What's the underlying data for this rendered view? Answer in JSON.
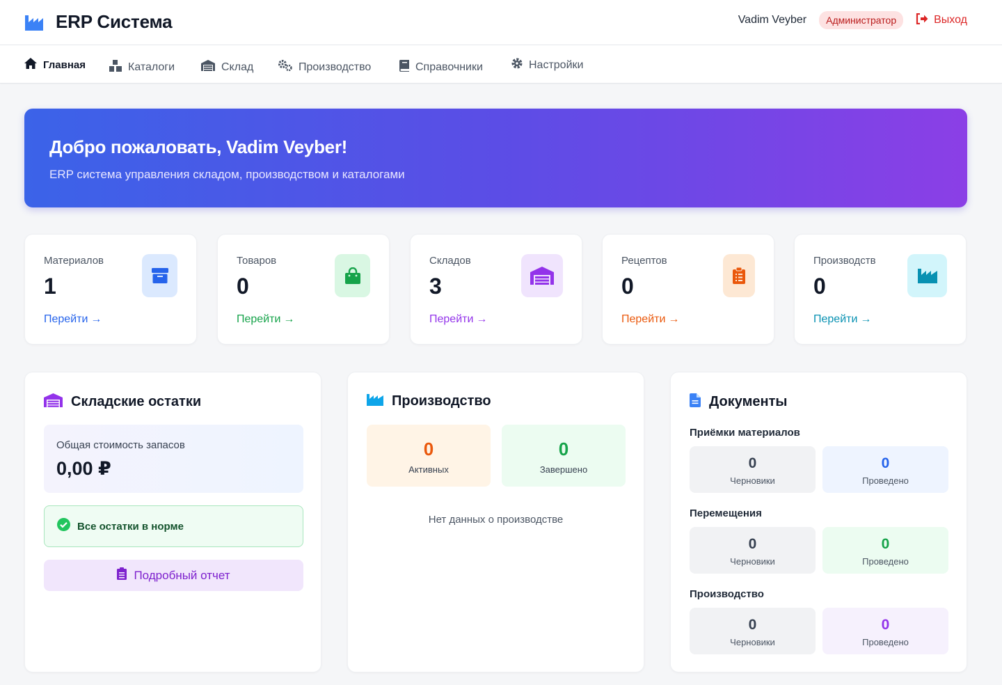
{
  "header": {
    "brand_title": "ERP Система",
    "user_name": "Vadim Veyber",
    "role": "Администратор",
    "logout_label": "Выход"
  },
  "nav": {
    "items": [
      {
        "label": "Главная",
        "icon": "home-icon",
        "active": true
      },
      {
        "label": "Каталоги",
        "icon": "cubes-icon"
      },
      {
        "label": "Склад",
        "icon": "warehouse-icon"
      },
      {
        "label": "Производство",
        "icon": "gears-icon"
      },
      {
        "label": "Справочники",
        "icon": "book-icon"
      },
      {
        "label": "Настройки",
        "icon": "cog-icon"
      }
    ]
  },
  "banner": {
    "title": "Добро пожаловать, Vadim Veyber!",
    "subtitle": "ERP система управления складом, производством и каталогами"
  },
  "stats": [
    {
      "label": "Материалов",
      "value": "1",
      "link": "Перейти",
      "icon": "box-icon",
      "color": "#2563eb"
    },
    {
      "label": "Товаров",
      "value": "0",
      "link": "Перейти",
      "icon": "shopping-bag-icon",
      "color": "#16a34a"
    },
    {
      "label": "Складов",
      "value": "3",
      "link": "Перейти",
      "icon": "warehouse-icon",
      "color": "#9333ea"
    },
    {
      "label": "Рецептов",
      "value": "0",
      "link": "Перейти",
      "icon": "clipboard-list-icon",
      "color": "#ea580c"
    },
    {
      "label": "Производств",
      "value": "0",
      "link": "Перейти",
      "icon": "industry-icon",
      "color": "#0891b2"
    }
  ],
  "stock": {
    "title": "Складские остатки",
    "total_label": "Общая стоимость запасов",
    "total_value": "0,00 ₽",
    "status_text": "Все остатки в норме",
    "report_button": "Подробный отчет"
  },
  "production": {
    "title": "Производство",
    "active_value": "0",
    "active_label": "Активных",
    "done_value": "0",
    "done_label": "Завершено",
    "empty_text": "Нет данных о производстве"
  },
  "documents": {
    "title": "Документы",
    "sections": [
      {
        "title": "Приёмки материалов",
        "draft_value": "0",
        "draft_label": "Черновики",
        "posted_value": "0",
        "posted_label": "Проведено",
        "posted_color": "#2563eb"
      },
      {
        "title": "Перемещения",
        "draft_value": "0",
        "draft_label": "Черновики",
        "posted_value": "0",
        "posted_label": "Проведено",
        "posted_color": "#16a34a"
      },
      {
        "title": "Производство",
        "draft_value": "0",
        "draft_label": "Черновики",
        "posted_value": "0",
        "posted_label": "Проведено",
        "posted_color": "#9333ea"
      }
    ]
  }
}
